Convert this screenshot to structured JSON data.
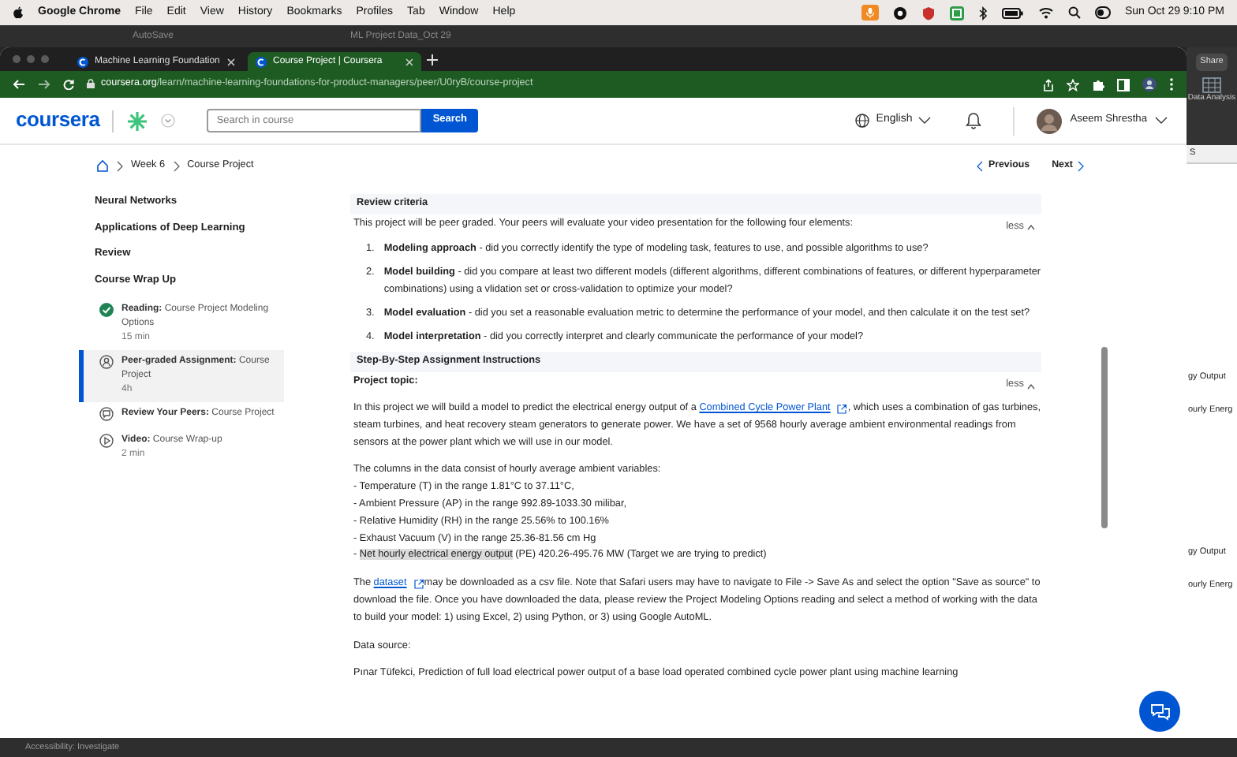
{
  "menubar": {
    "app": "Google Chrome",
    "menus": [
      "File",
      "Edit",
      "View",
      "History",
      "Bookmarks",
      "Profiles",
      "Tab",
      "Window",
      "Help"
    ],
    "clock": "Sun Oct 29  9:10 PM"
  },
  "background_window": {
    "autosave": "AutoSave",
    "title": "ML Project Data_Oct 29",
    "share": "Share",
    "ribbon_button": "Data Analysis",
    "column_header": "S",
    "cells": [
      "gy Output",
      "ourly Energ",
      "gy Output",
      "ourly Energ"
    ],
    "status": "Accessibility: Investigate"
  },
  "browser": {
    "tabs": [
      {
        "title": "Machine Learning Foundation",
        "selected": false
      },
      {
        "title": "Course Project | Coursera",
        "selected": true
      }
    ],
    "url_domain": "coursera.org",
    "url_path": "/learn/machine-learning-foundations-for-product-managers/peer/U0ryB/course-project"
  },
  "header": {
    "logo": "coursera",
    "search_placeholder": "Search in course",
    "search_button": "Search",
    "language": "English",
    "user": "Aseem Shrestha"
  },
  "breadcrumb": [
    "Week 6",
    "Course Project"
  ],
  "pager": {
    "previous": "Previous",
    "next": "Next"
  },
  "sidebar": {
    "sections": [
      "Neural Networks",
      "Applications of Deep Learning",
      "Review",
      "Course Wrap Up"
    ],
    "items": [
      {
        "kind": "reading",
        "label": "**Reading:** Course Project Modeling Options",
        "duration": "15 min",
        "completed": true,
        "selected": false
      },
      {
        "kind": "assignment",
        "label": "**Peer-graded Assignment:** Course Project",
        "duration": "4h",
        "completed": false,
        "selected": true
      },
      {
        "kind": "review",
        "label": "**Review Your Peers:** Course Project",
        "completed": false,
        "selected": false
      },
      {
        "kind": "video",
        "label": "**Video:** Course Wrap-up",
        "duration": "2 min",
        "completed": false,
        "selected": false
      }
    ]
  },
  "review_criteria": {
    "heading": "Review criteria",
    "toggle": "less",
    "intro": "This project will be peer graded.  Your peers will evaluate your video presentation for the following four elements:",
    "items": [
      {
        "marker": "1.",
        "text": "**Modeling approach** - did you correctly identify the type of modeling task, features to use, and possible algorithms to use?"
      },
      {
        "marker": "2.",
        "text": "**Model building**  - did you compare at least two different models (different algorithms, different combinations of features, or different hyperparameter combinations) using a vlidation set or cross-validation to optimize your model?"
      },
      {
        "marker": "3.",
        "text": "**Model evaluation** - did you set a reasonable evaluation metric to determine the performance of your model, and then calculate it on the test set?"
      },
      {
        "marker": "4.",
        "text": "**Model interpretation** - did you correctly interpret and clearly communicate the performance of your model?"
      }
    ]
  },
  "instructions": {
    "heading": "Step-By-Step Assignment Instructions",
    "toggle": "less",
    "topic_label": "Project topic:",
    "topic_before": "In this project we will build a model to predict the electrical energy output of a ",
    "topic_link": "Combined Cycle Power Plant",
    "topic_after": ", which uses a combination of gas turbines, steam turbines, and heat recovery steam generators to generate power.  We have a set of 9568 hourly average ambient environmental readings from sensors at the power plant which we will use in our model.",
    "columns_intro": "The columns in the data consist of hourly average ambient variables:",
    "columns": [
      {
        "text": "- Temperature (T) in the range 1.81°C to 37.11°C,"
      },
      {
        "text": "- Ambient Pressure (AP) in the range 992.89-1033.30 milibar,"
      },
      {
        "text": "- Relative Humidity (RH) in the range 25.56% to 100.16%"
      },
      {
        "text": "- Exhaust Vacuum (V) in the range 25.36-81.56 cm Hg"
      },
      {
        "text": "- ",
        "highlighted": "Net hourly electrical energy output",
        "after": " (PE) 420.26-495.76 MW (Target we are trying to predict)"
      }
    ],
    "dataset_before": "The ",
    "dataset_link": "dataset",
    "dataset_after": "may be downloaded as a csv file.  Note that Safari users may have to navigate to File -> Save As and select the option \"Save as source\" to download the file.  Once you have downloaded the data, please review the Project Modeling Options reading and select a method of working with the data to build your model: 1) using Excel, 2) using Python, or 3) using Google AutoML.",
    "source_label": "Data source:",
    "citation": "Pınar Tüfekci, Prediction of full load electrical power output of a base load operated combined cycle power plant using machine learning"
  }
}
